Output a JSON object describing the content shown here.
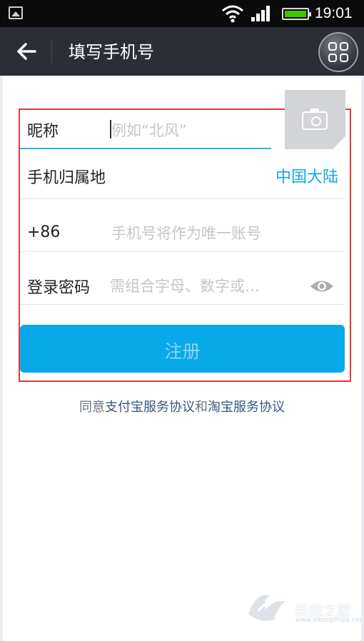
{
  "status_bar": {
    "time": "19:01"
  },
  "title_bar": {
    "title": "填写手机号"
  },
  "form": {
    "nickname": {
      "label": "昵称",
      "placeholder": "例如“北风”"
    },
    "region": {
      "label": "手机归属地",
      "value": "中国大陆"
    },
    "phone": {
      "prefix": "+86",
      "placeholder": "手机号将作为唯一账号"
    },
    "password": {
      "label": "登录密码",
      "placeholder": "需组合字母、数字或…"
    },
    "register_label": "注册"
  },
  "agreement": {
    "prefix": "同意",
    "link1": "支付宝服务协议",
    "conjunction": "和",
    "link2": "淘宝服务协议"
  },
  "watermark": {
    "text": "系统之家",
    "sub": "www.xitongzhijia.net"
  },
  "colors": {
    "accent": "#08a9e8",
    "link": "#13a6df",
    "highlight_frame": "#e03a3a"
  }
}
